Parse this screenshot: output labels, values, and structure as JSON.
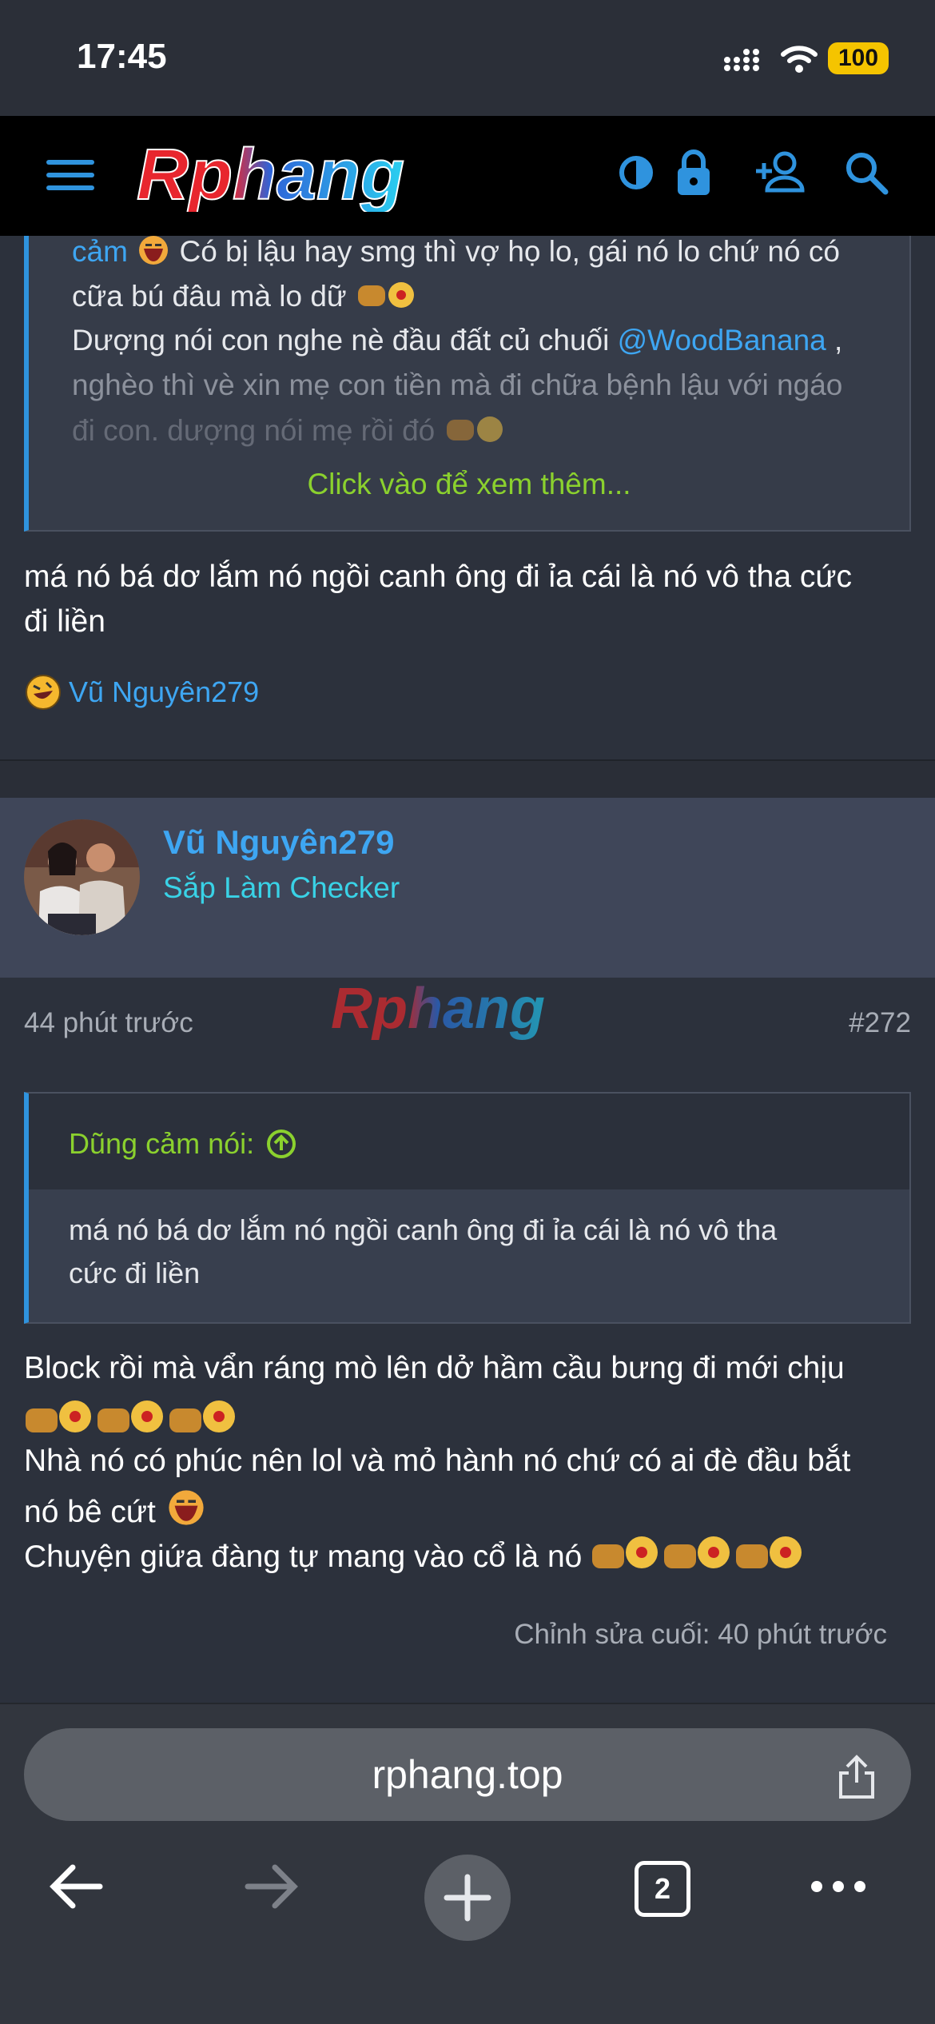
{
  "status_bar": {
    "time": "17:45",
    "battery": "100"
  },
  "header": {
    "logo_text": "Rphang"
  },
  "quote_top": {
    "line1_link": "cảm",
    "line1_text": " Có bị lậu hay smg thì vợ họ lo, gái nó lo chứ nó có",
    "line2": "cữa bú đâu mà lo dữ",
    "line3_text": "Dượng nói con nghe nè đầu đất củ chuối ",
    "line3_mention": "@WoodBanana",
    "line3_end": " ,",
    "line4": "nghèo thì vè xin mẹ con tiền mà đi chữa bệnh lậu với ngáo",
    "line5": "đi con. dượng nói mẹ rồi đó",
    "click_more": "Click vào để xem thêm..."
  },
  "post_prev": {
    "line1": "má nó bá dơ lắm nó ngồi canh ông đi ỉa cái là nó vô tha cức",
    "line2": "đi liền",
    "reaction_user": "Vũ Nguyên279"
  },
  "post": {
    "username": "Vũ Nguyên279",
    "role": "Sắp Làm Checker",
    "time": "44 phút trước",
    "number": "#272",
    "watermark": "Rphang",
    "quote_author": "Dũng cảm nói:",
    "quote_line1": "má nó bá dơ lắm nó ngồi canh ông đi ỉa cái là nó vô tha",
    "quote_line2": "cức đi liền",
    "body_line1": "Block rồi mà vẩn ráng mò lên dở hầm cầu bưng đi mới chịu",
    "body_line3": "Nhà nó có phúc nên lol và mỏ hành nó chứ có ai đè đầu bắt",
    "body_line4": "nó bê cứt",
    "body_line5": "Chuyện giứa đàng tự mang vào cổ là nó",
    "edited": "Chỉnh sửa cuối: 40 phút trước"
  },
  "browser": {
    "url": "rphang.top",
    "tab_count": "2"
  },
  "colors": {
    "link": "#3ea6f2",
    "accent_green": "#8bd12e",
    "role": "#39d2e6",
    "battery": "#f5c400"
  }
}
